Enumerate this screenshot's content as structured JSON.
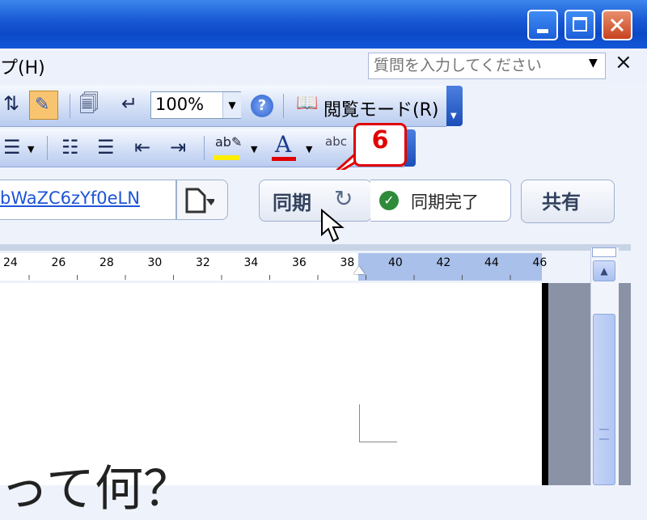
{
  "menu": {
    "help": "プ(H)",
    "help_placeholder": "質問を入力してください",
    "close_glyph": "×"
  },
  "toolbar1": {
    "zoom": "100%",
    "reading_mode": "閲覧モード(R)"
  },
  "syncbar": {
    "document_name": "bWaZC6zYf0eLN",
    "sync_button": "同期",
    "sync_status": "同期完了",
    "share_button": "共有"
  },
  "callout": {
    "number": "6"
  },
  "ruler": {
    "labels": [
      "24",
      "26",
      "28",
      "30",
      "32",
      "34",
      "36",
      "38",
      "40",
      "42",
      "44",
      "46"
    ]
  },
  "document": {
    "heading": "って何？"
  },
  "colors": {
    "titlebar": "#0c49c6",
    "callout": "#e10000",
    "link": "#1c55d8",
    "sync_check": "#2e8b3a"
  }
}
